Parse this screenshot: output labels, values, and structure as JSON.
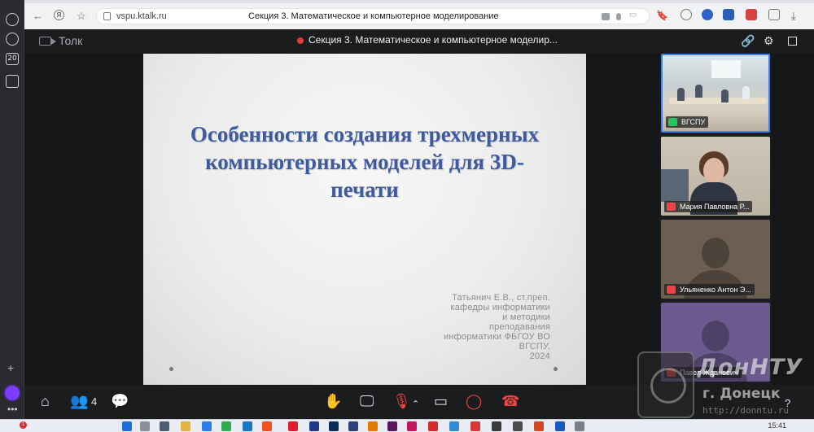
{
  "browser": {
    "url": "vspu.ktalk.ru",
    "page_title": "Секция 3. Математическое и компьютерное моделирование"
  },
  "rail": {
    "counter_badge": "20"
  },
  "meeting": {
    "app_name": "Толк",
    "title": "Секция 3. Математическое и компьютерное моделир..."
  },
  "slide": {
    "title": "Особенности создания трехмерных компьютерных моделей для 3D-печати",
    "author_lines": [
      "Татьянич Е.В., ст.преп.",
      "кафедры информатики",
      "и методики",
      "преподавания",
      "информатики ФБГОУ ВО",
      "ВГСПУ.",
      "2024"
    ]
  },
  "participants": [
    {
      "name": "ВГСПУ",
      "status": "screen-share",
      "status_color": "#22c55e"
    },
    {
      "name": "Мария Павловна Р...",
      "status": "mic-off",
      "status_color": "#ef4444"
    },
    {
      "name": "Ульяненко Антон Э...",
      "status": "mic-off",
      "status_color": "#ef4444"
    },
    {
      "name": "Павел Жданович",
      "status": "mic-off",
      "status_color": "#ef4444"
    }
  ],
  "controls": {
    "participants_count": "4",
    "help": "?"
  },
  "watermark": {
    "org": "ДонНТУ",
    "city": "г. Донецк",
    "site": "http://donntu.ru"
  },
  "taskbar": {
    "clock": "15:41",
    "notification_count": "1"
  },
  "colors": {
    "slide_title": "#3e5ba0",
    "active_tile_border": "#3b82f6",
    "record_dot": "#e23b3b",
    "mic_off": "#ef4444"
  }
}
